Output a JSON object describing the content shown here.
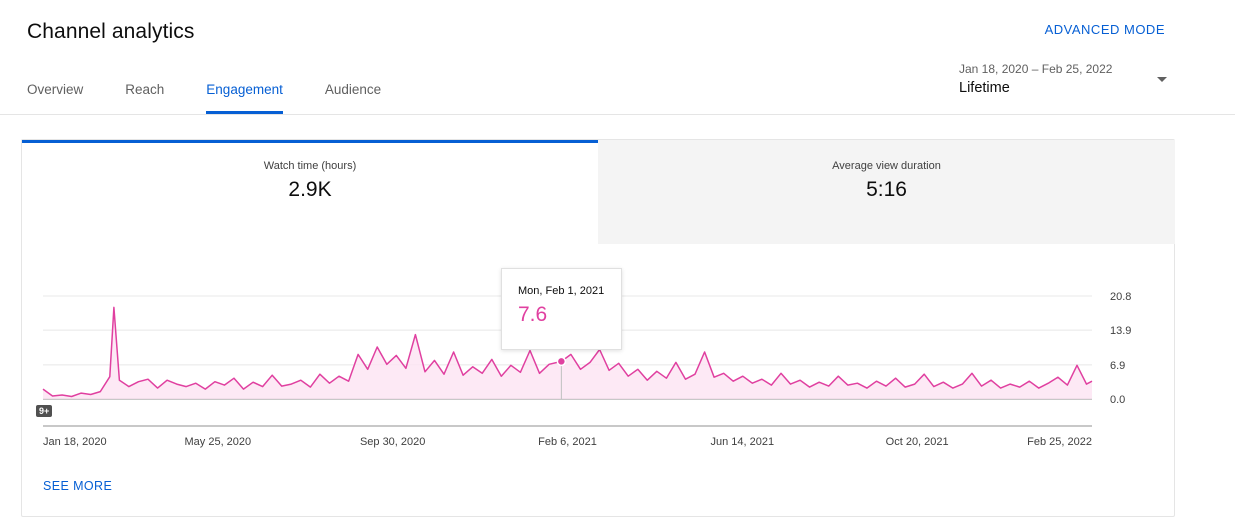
{
  "page": {
    "title": "Channel analytics",
    "advanced_mode": "ADVANCED MODE"
  },
  "tabs": [
    {
      "label": "Overview",
      "active": false
    },
    {
      "label": "Reach",
      "active": false
    },
    {
      "label": "Engagement",
      "active": true
    },
    {
      "label": "Audience",
      "active": false
    }
  ],
  "date_selector": {
    "range": "Jan 18, 2020 – Feb 25, 2022",
    "label": "Lifetime"
  },
  "metrics": [
    {
      "label": "Watch time (hours)",
      "value": "2.9K",
      "selected": true
    },
    {
      "label": "Average view duration",
      "value": "5:16",
      "selected": false
    }
  ],
  "tooltip": {
    "date": "Mon, Feb 1, 2021",
    "value": "7.6"
  },
  "badge": "9+",
  "see_more": "SEE MORE",
  "colors": {
    "accent": "#065fd4",
    "series": "#e040a0",
    "fill": "#fce4f2"
  },
  "chart_data": {
    "type": "area",
    "title": "",
    "xlabel": "",
    "ylabel": "",
    "x_tick_labels": [
      "Jan 18, 2020",
      "May 25, 2020",
      "Sep 30, 2020",
      "Feb 6, 2021",
      "Jun 14, 2021",
      "Oct 20, 2021",
      "Feb 25, 2022"
    ],
    "y_tick_labels": [
      "20.8",
      "13.9",
      "6.9",
      "0.0"
    ],
    "y_ticks": [
      20.8,
      13.9,
      6.9,
      0.0
    ],
    "ylim": [
      0,
      20.8
    ],
    "xlim": [
      "2020-01-18",
      "2022-02-25"
    ],
    "highlight": {
      "x": "2021-02-01",
      "y": 7.6
    },
    "series": [
      {
        "values_note": "",
        "x": [
          "2020-01-18",
          "2020-01-25",
          "2020-02-01",
          "2020-02-08",
          "2020-02-15",
          "2020-02-22",
          "2020-02-29",
          "2020-03-07",
          "2020-03-10",
          "2020-03-14",
          "2020-03-21",
          "2020-03-28",
          "2020-04-04",
          "2020-04-11",
          "2020-04-18",
          "2020-04-25",
          "2020-05-02",
          "2020-05-09",
          "2020-05-16",
          "2020-05-23",
          "2020-05-30",
          "2020-06-06",
          "2020-06-13",
          "2020-06-20",
          "2020-06-27",
          "2020-07-04",
          "2020-07-11",
          "2020-07-18",
          "2020-07-25",
          "2020-08-01",
          "2020-08-08",
          "2020-08-15",
          "2020-08-22",
          "2020-08-29",
          "2020-09-05",
          "2020-09-12",
          "2020-09-19",
          "2020-09-26",
          "2020-10-03",
          "2020-10-10",
          "2020-10-17",
          "2020-10-24",
          "2020-10-31",
          "2020-11-07",
          "2020-11-14",
          "2020-11-21",
          "2020-11-28",
          "2020-12-05",
          "2020-12-12",
          "2020-12-19",
          "2020-12-26",
          "2021-01-02",
          "2021-01-09",
          "2021-01-16",
          "2021-01-23",
          "2021-02-01",
          "2021-02-08",
          "2021-02-15",
          "2021-02-22",
          "2021-03-01",
          "2021-03-08",
          "2021-03-15",
          "2021-03-22",
          "2021-03-29",
          "2021-04-05",
          "2021-04-12",
          "2021-04-19",
          "2021-04-26",
          "2021-05-03",
          "2021-05-10",
          "2021-05-17",
          "2021-05-24",
          "2021-05-31",
          "2021-06-07",
          "2021-06-14",
          "2021-06-21",
          "2021-06-28",
          "2021-07-05",
          "2021-07-12",
          "2021-07-19",
          "2021-07-26",
          "2021-08-02",
          "2021-08-09",
          "2021-08-16",
          "2021-08-23",
          "2021-08-30",
          "2021-09-06",
          "2021-09-13",
          "2021-09-20",
          "2021-09-27",
          "2021-10-04",
          "2021-10-11",
          "2021-10-18",
          "2021-10-25",
          "2021-11-01",
          "2021-11-08",
          "2021-11-15",
          "2021-11-22",
          "2021-11-29",
          "2021-12-06",
          "2021-12-13",
          "2021-12-20",
          "2021-12-27",
          "2022-01-03",
          "2022-01-10",
          "2022-01-17",
          "2022-01-24",
          "2022-01-31",
          "2022-02-07",
          "2022-02-14",
          "2022-02-21",
          "2022-02-25"
        ],
        "values": [
          2.0,
          0.6,
          0.8,
          0.5,
          1.2,
          0.9,
          1.5,
          4.5,
          18.5,
          3.8,
          2.5,
          3.5,
          4.0,
          2.2,
          3.8,
          3.0,
          2.5,
          3.2,
          2.0,
          3.5,
          2.8,
          4.2,
          2.0,
          3.4,
          2.5,
          4.8,
          2.6,
          3.0,
          3.8,
          2.4,
          5.0,
          3.2,
          4.6,
          3.6,
          9.0,
          6.0,
          10.5,
          7.0,
          8.8,
          6.2,
          13.0,
          5.5,
          7.8,
          5.0,
          9.5,
          4.8,
          6.5,
          5.2,
          8.0,
          4.6,
          6.8,
          5.4,
          9.8,
          5.2,
          7.0,
          7.6,
          9.0,
          6.0,
          7.4,
          10.0,
          5.8,
          7.2,
          4.6,
          6.0,
          3.8,
          5.6,
          4.2,
          7.4,
          4.0,
          5.0,
          9.5,
          4.4,
          5.2,
          3.6,
          4.6,
          3.2,
          4.0,
          2.8,
          5.2,
          3.0,
          3.8,
          2.4,
          3.4,
          2.6,
          4.6,
          2.8,
          3.2,
          2.2,
          3.6,
          2.6,
          4.2,
          2.4,
          3.0,
          5.0,
          2.5,
          3.4,
          2.2,
          3.0,
          5.2,
          2.6,
          3.8,
          2.2,
          3.0,
          2.4,
          3.6,
          2.2,
          3.2,
          4.4,
          2.8,
          6.8,
          3.0,
          3.6
        ]
      }
    ]
  }
}
